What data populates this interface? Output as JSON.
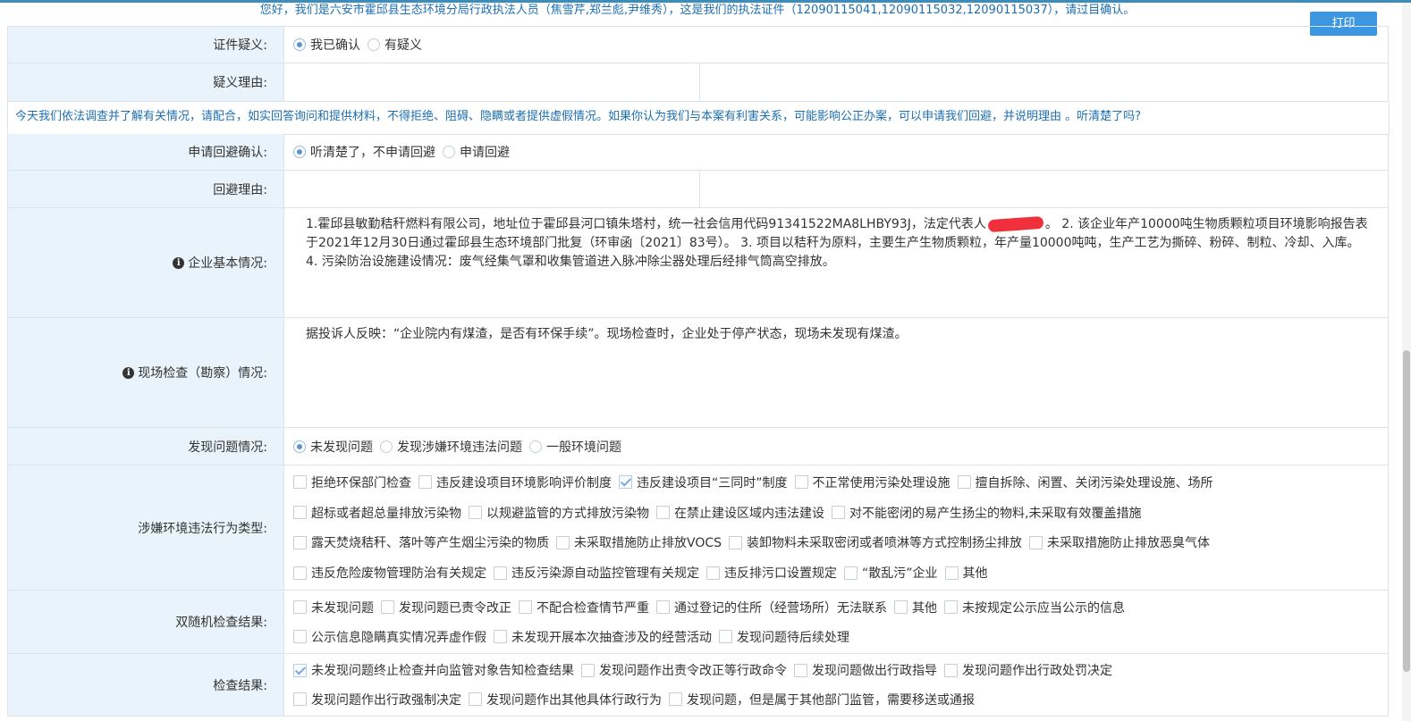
{
  "notice_top": "您好，我们是六安市霍邱县生态环境分局行政执法人员（焦雪芹,郑兰彪,尹维秀），这是我们的执法证件（12090115041,12090115032,12090115037），请过目确认。",
  "print_label": "打印",
  "cert": {
    "label": "证件疑义:",
    "options": [
      "我已确认",
      "有疑义"
    ]
  },
  "doubt_reason": {
    "label": "疑义理由:"
  },
  "notice_mid": "今天我们依法调查并了解有关情况，请配合，如实回答询问和提供材料，不得拒绝、阻碍、隐瞒或者提供虚假情况。如果你认为我们与本案有利害关系，可能影响公正办案，可以申请我们回避，并说明理由 。听清楚了吗?",
  "avoid": {
    "label": "申请回避确认:",
    "options": [
      "听清楚了，不申请回避",
      "申请回避"
    ]
  },
  "avoid_reason": {
    "label": "回避理由:"
  },
  "enterprise": {
    "label": "企业基本情况:",
    "text_a": "1.霍邱县敏勤秸秆燃料有限公司，地址位于霍邱县河口镇朱塔村，统一社会信用代码91341522MA8LHBY93J，法定代表人",
    "text_b": "。 2. 该企业年产10000吨生物质颗粒项目环境影响报告表于2021年12月30日通过霍邱县生态环境部门批复（环审函〔2021〕83号）。  3. 项目以秸秆为原料，主要生产生物质颗粒，年产量10000吨吨，生产工艺为撕碎、粉碎、制粒、冷却、入库。  4. 污染防治设施建设情况：废气经集气罩和收集管道进入脉冲除尘器处理后经排气筒高空排放。"
  },
  "inspection": {
    "label": "现场检查（勘察）情况:",
    "text": "据投诉人反映：“企业院内有煤渣，是否有环保手续”。现场检查时，企业处于停产状态，现场未发现有煤渣。"
  },
  "problem": {
    "label": "发现问题情况:",
    "options": [
      "未发现问题",
      "发现涉嫌环境违法问题",
      "一般环境问题"
    ]
  },
  "violation": {
    "label": "涉嫌环境违法行为类型:",
    "lines": [
      [
        "拒绝环保部门检查",
        "违反建设项目环境影响评价制度",
        "违反建设项目“三同时”制度",
        "不正常使用污染处理设施",
        "擅自拆除、闲置、关闭污染处理设施、场所"
      ],
      [
        "超标或者超总量排放污染物",
        "以规避监管的方式排放污染物",
        "在禁止建设区域内违法建设",
        "对不能密闭的易产生扬尘的物料,未采取有效覆盖措施"
      ],
      [
        "露天焚烧秸秆、落叶等产生烟尘污染的物质",
        "未采取措施防止排放VOCS",
        "装卸物料未采取密闭或者喷淋等方式控制扬尘排放",
        "未采取措施防止排放恶臭气体"
      ],
      [
        "违反危险废物管理防治有关规定",
        "违反污染源自动监控管理有关规定",
        "违反排污口设置规定",
        "“散乱污”企业",
        "其他"
      ]
    ],
    "checked": [
      "违反建设项目“三同时”制度"
    ]
  },
  "random": {
    "label": "双随机检查结果:",
    "lines": [
      [
        "未发现问题",
        "发现问题已责令改正",
        "不配合检查情节严重",
        "通过登记的住所（经营场所）无法联系",
        "其他",
        "未按规定公示应当公示的信息"
      ],
      [
        "公示信息隐瞒真实情况弄虚作假",
        "未发现开展本次抽查涉及的经营活动",
        "发现问题待后续处理"
      ]
    ],
    "checked": []
  },
  "result": {
    "label": "检查结果:",
    "lines": [
      [
        "未发现问题终止检查并向监管对象告知检查结果",
        "发现问题作出责令改正等行政命令",
        "发现问题做出行政指导",
        "发现问题作出行政处罚决定"
      ],
      [
        "发现问题作出行政强制决定",
        "发现问题作出其他具体行政行为",
        "发现问题，但是属于其他部门监管，需要移送或通报"
      ]
    ],
    "checked": [
      "未发现问题终止检查并向监管对象告知检查结果"
    ]
  }
}
